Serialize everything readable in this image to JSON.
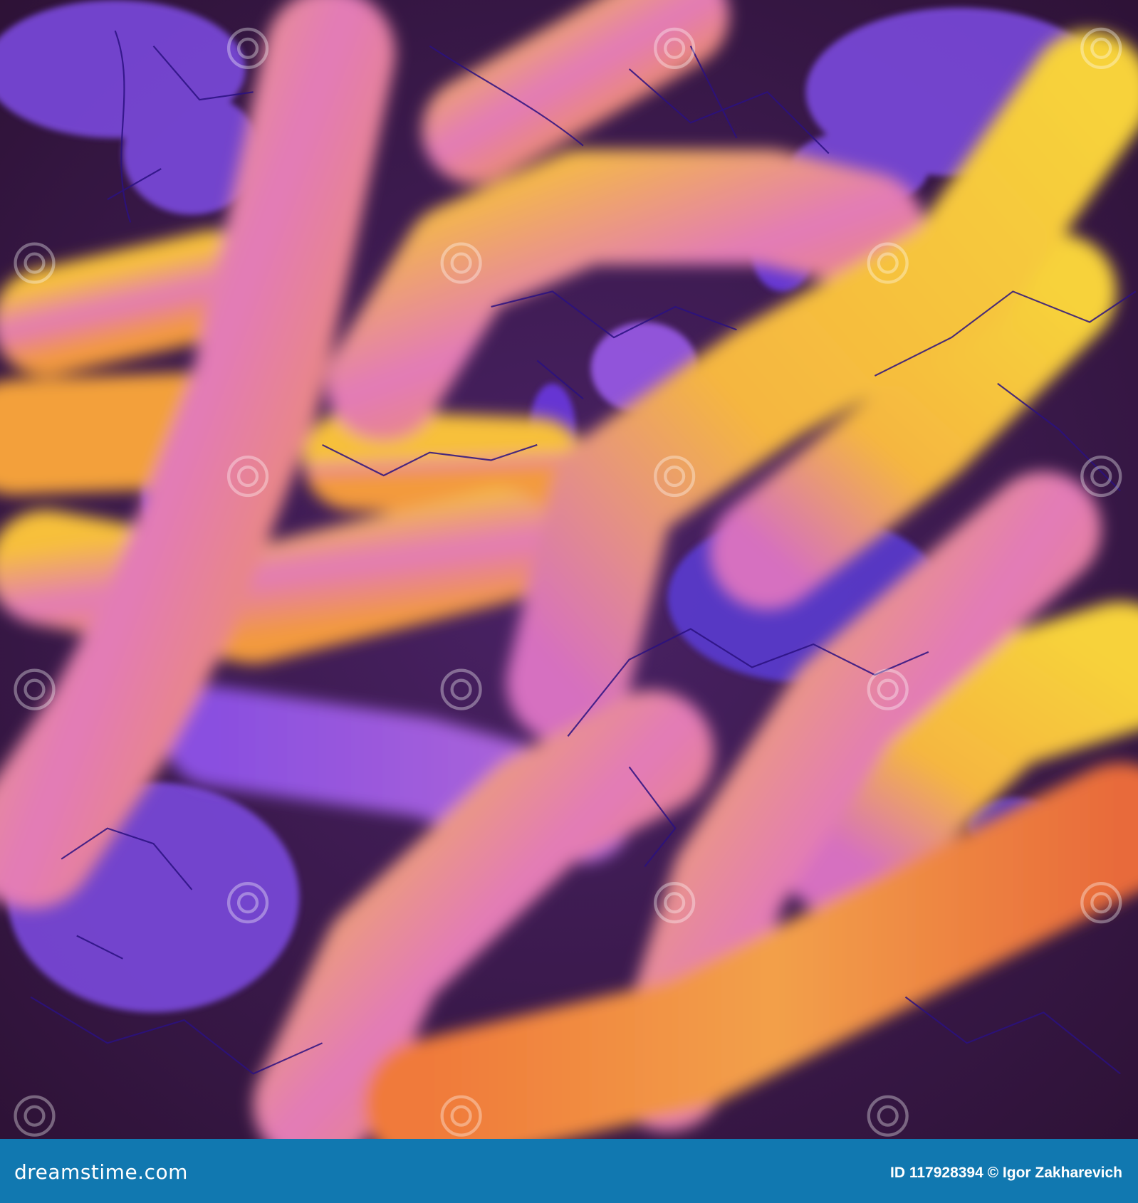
{
  "image": {
    "watermark_text": "dreamstime",
    "colors": {
      "background": "#2e1440",
      "orange": "#f39a3c",
      "yellow": "#f7d23a",
      "pink": "#e07ab0",
      "purple": "#8a4fe0",
      "violet": "#5a2fd0",
      "footer": "#1178b0"
    }
  },
  "footer": {
    "logo_text": "dreamstime.com",
    "credit": "ID 117928394 © Igor Zakharevich"
  }
}
